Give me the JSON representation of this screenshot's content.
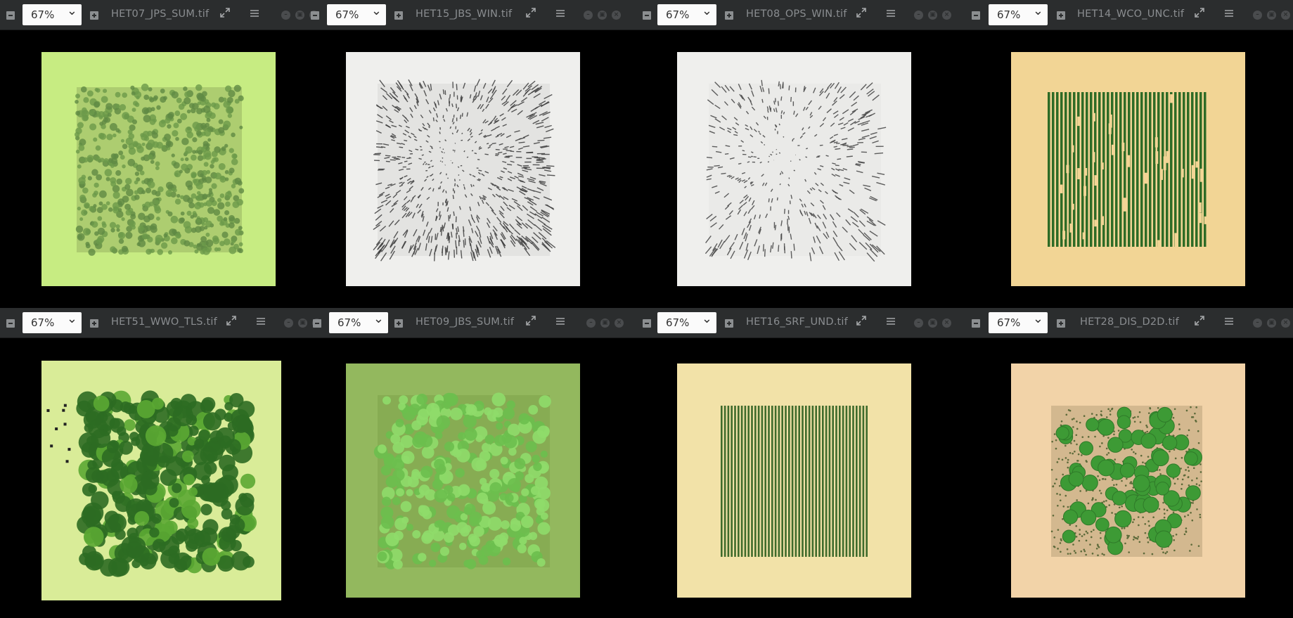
{
  "panes": [
    {
      "zoom": "67%",
      "filename": "HET07_JPS_SUM.tif",
      "bg": "#c7ec82",
      "canopy": "#6b9a4a",
      "style": "olive-grove"
    },
    {
      "zoom": "67%",
      "filename": "HET15_JBS_WIN.tif",
      "bg": "#efefed",
      "canopy": "#3d3d3d",
      "style": "bare-winter"
    },
    {
      "zoom": "67%",
      "filename": "HET08_OPS_WIN.tif",
      "bg": "#efefed",
      "canopy": "#444444",
      "style": "sparse-winter"
    },
    {
      "zoom": "67%",
      "filename": "HET14_WCO_UNC.tif",
      "bg": "#f2d595",
      "canopy": "#2e6b26",
      "style": "rows"
    },
    {
      "zoom": "67%",
      "filename": "HET51_WWO_TLS.tif",
      "bg": "#d9ec98",
      "canopy": "#2c6b22",
      "style": "dense-forest"
    },
    {
      "zoom": "67%",
      "filename": "HET09_JBS_SUM.tif",
      "bg": "#93b85e",
      "canopy": "#6cbf4e",
      "style": "summer-crowns"
    },
    {
      "zoom": "67%",
      "filename": "HET16_SRF_UND.tif",
      "bg": "#f2e2a8",
      "canopy": "#3f6b2c",
      "style": "fine-rows"
    },
    {
      "zoom": "67%",
      "filename": "HET28_DIS_D2D.tif",
      "bg": "#f2d3a8",
      "canopy": "#3d9a35",
      "style": "round-trees"
    }
  ],
  "icons": {
    "minimize": "minus-square-icon",
    "attach": "plus-square-icon",
    "expand": "expand-icon",
    "menu": "hamburger-menu-icon",
    "window_controls": [
      "minimize-circle-icon",
      "maximize-circle-icon",
      "close-circle-icon"
    ]
  }
}
